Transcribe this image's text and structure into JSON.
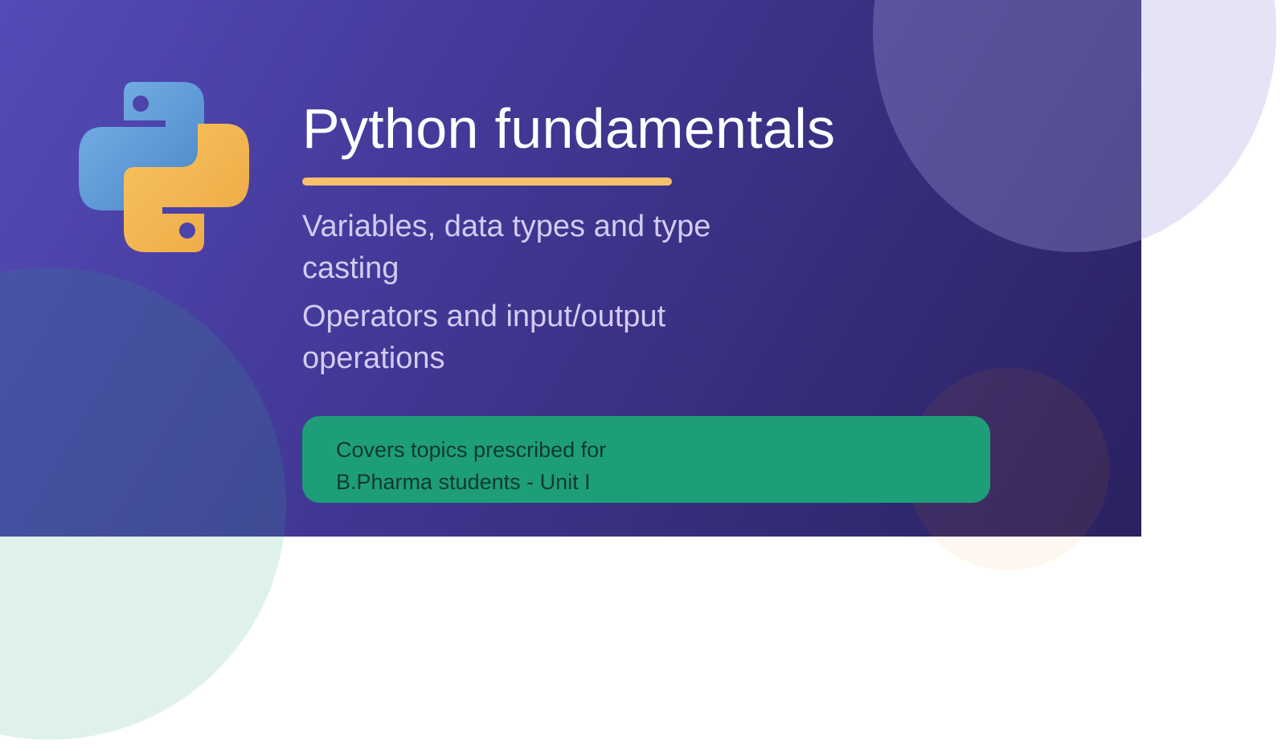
{
  "slide": {
    "title": "Python fundamentals",
    "topics": [
      "Variables, data types and type casting",
      "Operators and input/output operations"
    ],
    "note": "Covers topics prescribed for B.Pharma students - Unit I"
  },
  "icons": {
    "logo": "python-logo-icon"
  },
  "colors": {
    "banner_start": "#544bb8",
    "banner_end": "#2a2160",
    "title": "#ffffff",
    "underline": "#f7c06b",
    "topic_text": "#d4cbf2",
    "note_background": "#1e9e78",
    "note_text": "#103a2c",
    "python_blue": "#5b9bd5",
    "python_yellow": "#f3b04d"
  }
}
